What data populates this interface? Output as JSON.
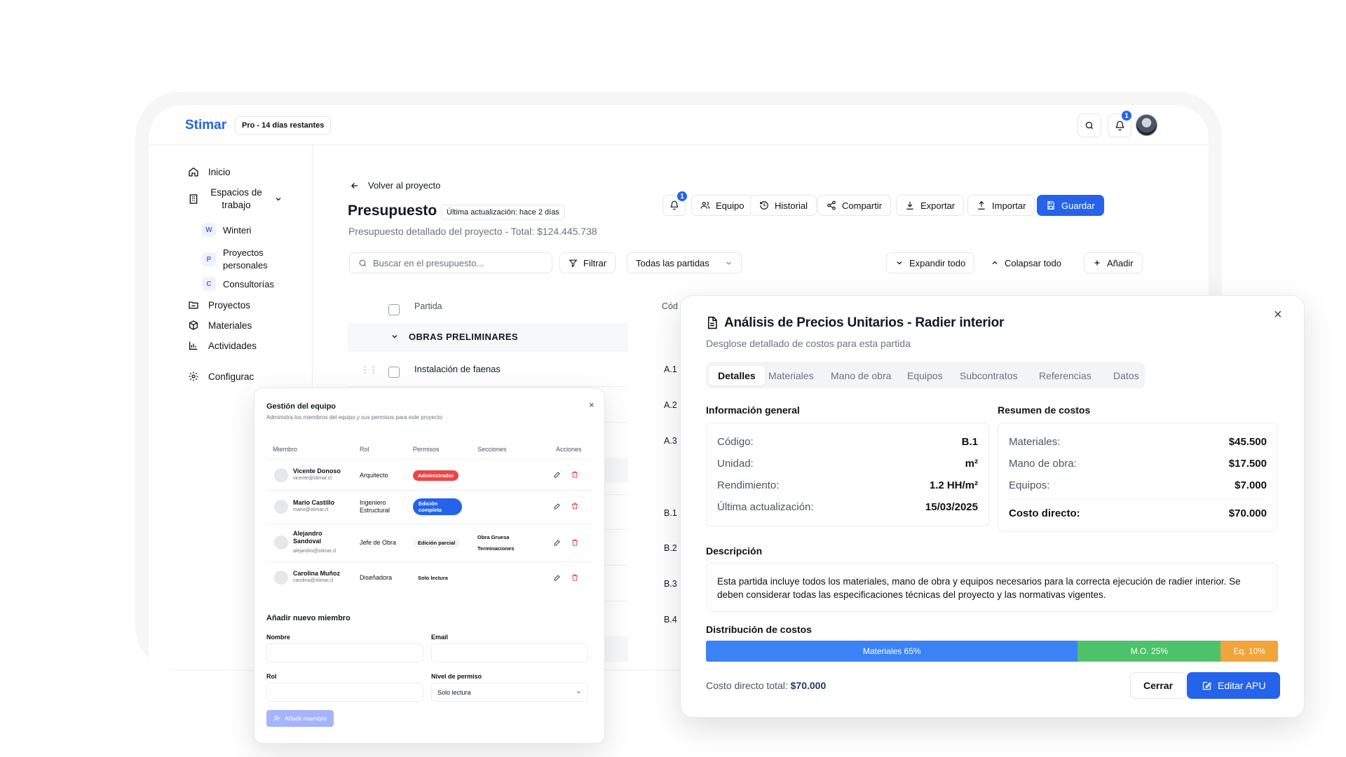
{
  "app": {
    "brand": "Stimar",
    "plan_badge": "Pro - 14 días restantes",
    "notifications_count": "1"
  },
  "sidebar": {
    "items": [
      {
        "label": "Inicio",
        "icon": "home-icon"
      },
      {
        "label": "Espacios de trabajo",
        "icon": "building-icon"
      },
      {
        "label": "Proyectos",
        "icon": "folder-icon"
      },
      {
        "label": "Materiales",
        "icon": "box-icon"
      },
      {
        "label": "Actividades",
        "icon": "chart-icon"
      },
      {
        "label": "Configurac",
        "icon": "gear-icon"
      }
    ],
    "workspaces": [
      {
        "letter": "W",
        "label": "Winteri"
      },
      {
        "letter": "P",
        "label": "Proyectos personales"
      },
      {
        "letter": "C",
        "label": "Consultorías"
      }
    ]
  },
  "main": {
    "back_link": "Volver al proyecto",
    "title": "Presupuesto",
    "updated_badge": "Última actualización: hace 2 días",
    "subtitle": "Presupuesto detallado del proyecto - Total: $124.445.738",
    "toolbar": {
      "notif_count": "1",
      "team": "Equipo",
      "history": "Historial",
      "share": "Compartir",
      "export": "Exportar",
      "import": "Importar",
      "save": "Guardar"
    },
    "search_placeholder": "Buscar en el presupuesto...",
    "filter": "Filtrar",
    "partidas_select": "Todas las partidas",
    "expand_all": "Expandir todo",
    "collapse_all": "Colapsar todo",
    "add": "Añadir",
    "table": {
      "col_partida": "Partida",
      "col_codigo": "Cód",
      "group": "OBRAS PRELIMINARES",
      "first_row": "Instalación de faenas",
      "codes": [
        "A.1",
        "A.2",
        "A.3",
        "B.1",
        "B.2",
        "B.3",
        "B.4"
      ]
    }
  },
  "team_dialog": {
    "title": "Gestión del equipo",
    "subtitle": "Administra los miembros del equipo y sus permisos para este proyecto",
    "headers": [
      "Miembro",
      "Rol",
      "Permisos",
      "Secciones",
      "Acciones"
    ],
    "members": [
      {
        "name": "Vicente Donoso",
        "email": "vicente@stimar.cl",
        "role": "Arquitecto",
        "perm": "Administrador",
        "perm_style": "red",
        "sections": ""
      },
      {
        "name": "Mario Castillo",
        "email": "mario@stimar.cl",
        "role": "Ingeniero Estructural",
        "perm": "Edición completa",
        "perm_style": "blue",
        "sections": ""
      },
      {
        "name": "Alejandro Sandoval",
        "email": "alejandro@stimar.cl",
        "role": "Jefe de Obra",
        "perm": "Edición parcial",
        "perm_style": "gray",
        "sections": "Obra Gruesa\nTerminaciones"
      },
      {
        "name": "Carolina Muñoz",
        "email": "carolina@stimar.cl",
        "role": "Diseñadora",
        "perm": "Solo lectura",
        "perm_style": "plain",
        "sections": ""
      }
    ],
    "add_section": "Añadir nuevo miembro",
    "field_name": "Nombre",
    "field_email": "Email",
    "field_role": "Rol",
    "field_level": "Nivel de permiso",
    "level_value": "Solo lectura",
    "add_button": "Añadir miembro",
    "colors": {
      "admin": "#ef4444",
      "full": "#2563eb",
      "disabled_btn": "#a5b4fc"
    }
  },
  "apu_dialog": {
    "title": "Análisis de Precios Unitarios - Radier interior",
    "subtitle": "Desglose detallado de costos para esta partida",
    "tabs": [
      "Detalles",
      "Materiales",
      "Mano de obra",
      "Equipos",
      "Subcontratos",
      "Referencias",
      "Datos"
    ],
    "info_title": "Información general",
    "info": [
      {
        "k": "Código:",
        "v": "B.1"
      },
      {
        "k": "Unidad:",
        "v": "m²"
      },
      {
        "k": "Rendimiento:",
        "v": "1.2 HH/m²"
      },
      {
        "k": "Última actualización:",
        "v": "15/03/2025"
      }
    ],
    "summary_title": "Resumen de costos",
    "summary": [
      {
        "k": "Materiales:",
        "v": "$45.500"
      },
      {
        "k": "Mano de obra:",
        "v": "$17.500"
      },
      {
        "k": "Equipos:",
        "v": "$7.000"
      }
    ],
    "direct_cost_label": "Costo directo:",
    "direct_cost_value": "$70.000",
    "description_title": "Descripción",
    "description": "Esta partida incluye todos los materiales, mano de obra y equipos necesarios para la correcta ejecución de radier interior. Se deben considerar todas las especificaciones técnicas del proyecto y las normativas vigentes.",
    "distribution_title": "Distribución de costos",
    "distribution": [
      {
        "label": "Materiales 65%",
        "share": 0.65,
        "color": "#3b82f6"
      },
      {
        "label": "M.O. 25%",
        "share": 0.25,
        "color": "#4ec26a"
      },
      {
        "label": "Eq. 10%",
        "share": 0.1,
        "color": "#f0a43a"
      }
    ],
    "footer_total_label": "Costo directo total:",
    "footer_total_value": "$70.000",
    "close_button": "Cerrar",
    "edit_button": "Editar APU"
  }
}
